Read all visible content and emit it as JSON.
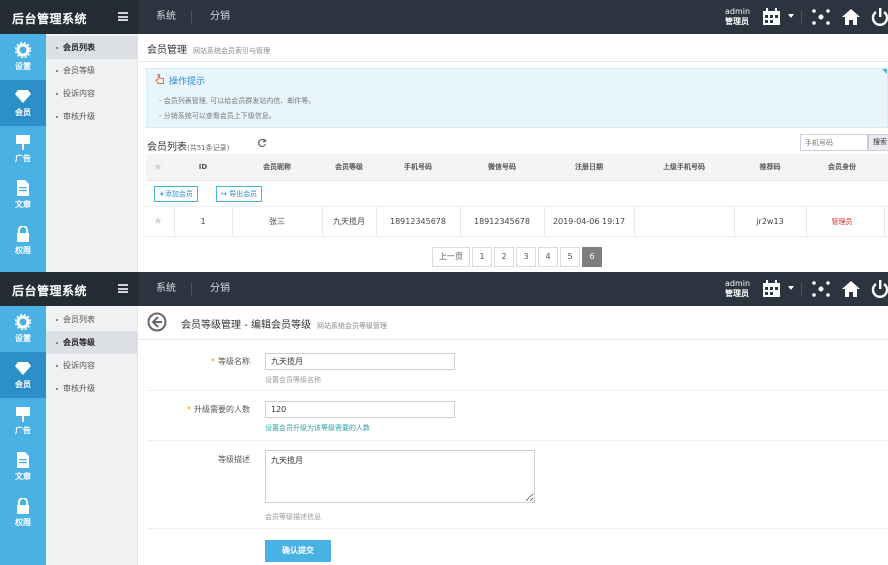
{
  "app": {
    "title": "后台管理系统"
  },
  "topnav": {
    "tabs": [
      "系统",
      "分销"
    ]
  },
  "user": {
    "name": "admin",
    "role": "管理员"
  },
  "iconbar": {
    "items": [
      "设置",
      "会员",
      "广告",
      "文章",
      "权限"
    ]
  },
  "submenu": {
    "items": [
      "会员列表",
      "会员等级",
      "投诉内容",
      "审核升级"
    ]
  },
  "list_page": {
    "title": "会员管理",
    "subtitle": "网站系统会员索引与管理",
    "tips": {
      "title": "操作提示",
      "lines": [
        "会员列表管理, 可以给会员群发站内信、邮件等。",
        "分销系统可以查看会员上下级信息。"
      ]
    },
    "list_title": "会员列表",
    "record_count": "(共51条记录)",
    "search": {
      "placeholder": "手机号码",
      "button": "搜索"
    },
    "columns": [
      "ID",
      "会员昵称",
      "会员等级",
      "手机号码",
      "微信号码",
      "注册日期",
      "上级手机号码",
      "推荐码",
      "会员身份"
    ],
    "toolbar": {
      "add": "添加会员",
      "export": "导出会员"
    },
    "rows": [
      {
        "id": "1",
        "nickname": "张三",
        "level": "九天揽月",
        "phone": "18912345678",
        "wechat": "18912345678",
        "date": "2019-04-06 19:17",
        "parent_phone": "",
        "ref_code": "jr2w13",
        "identity": "管理员"
      }
    ],
    "pager": {
      "prev": "上一页",
      "pages": [
        "1",
        "2",
        "3",
        "4",
        "5",
        "6"
      ],
      "current": "6"
    }
  },
  "edit_page": {
    "title": "会员等级管理 - 编辑会员等级",
    "subtitle": "网站系统会员等级管理",
    "fields": {
      "name": {
        "label": "等级名称",
        "value": "九天揽月",
        "hint": "设置会员等级名称"
      },
      "count": {
        "label": "升级需要的人数",
        "value": "120",
        "hint": "设置会员升级为该等级需要的人数"
      },
      "desc": {
        "label": "等级描述",
        "value": "九天揽月",
        "hint": "会员等级描述信息"
      }
    },
    "submit": "确认提交"
  },
  "colors": {
    "topbar": "#2c3440",
    "iconbar": "#4ab1e4",
    "accent": "#2b8bd0",
    "danger": "#e0242b"
  }
}
